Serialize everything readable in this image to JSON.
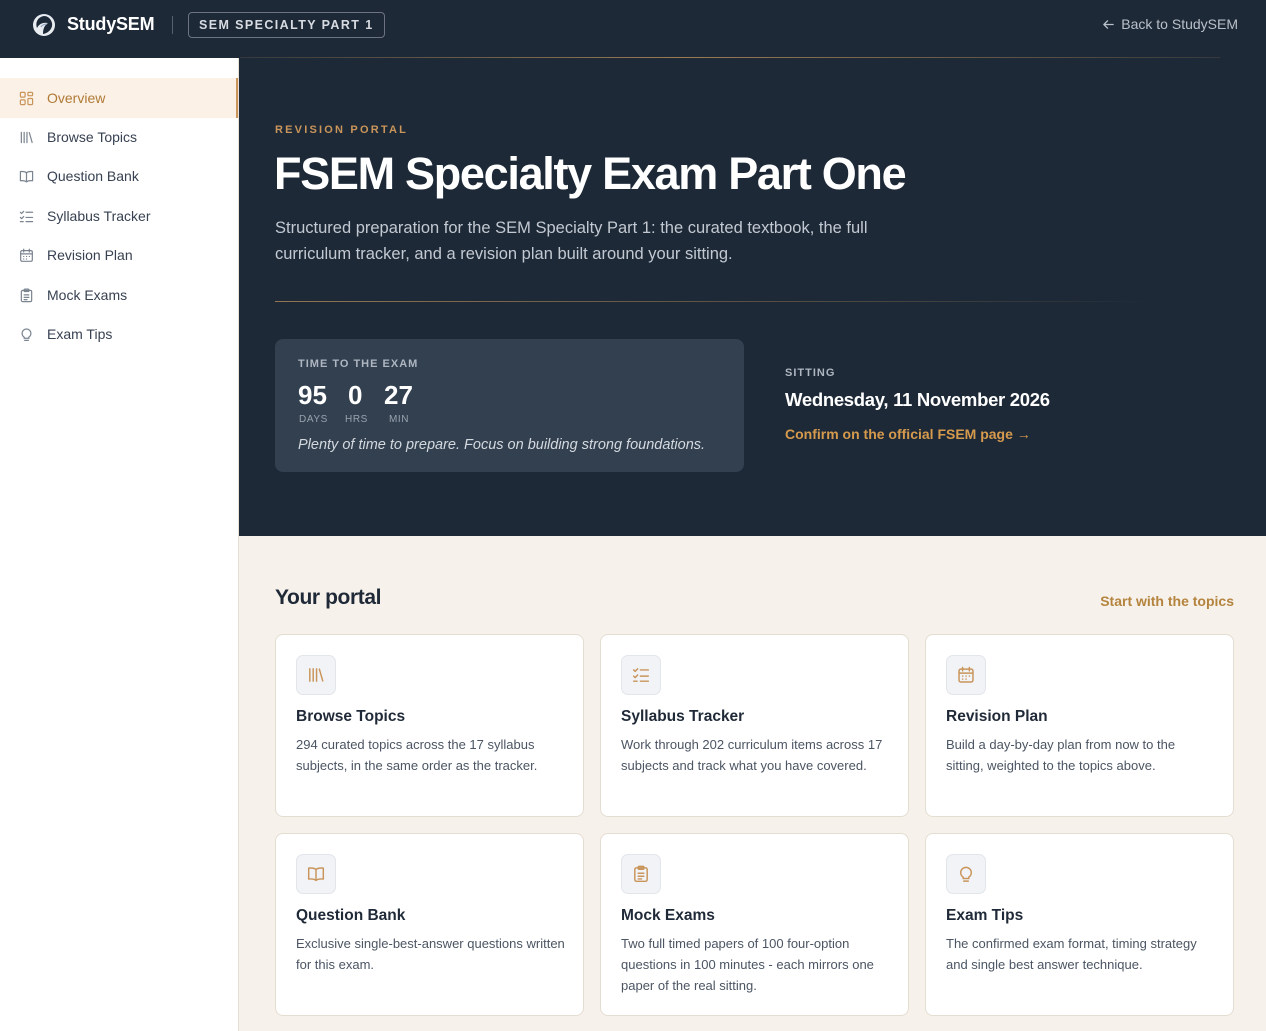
{
  "header": {
    "brand": "StudySEM",
    "badge": "SEM SPECIALTY PART 1",
    "back_link": "Back to StudySEM"
  },
  "sidebar": {
    "items": [
      {
        "label": "Overview",
        "icon": "grid-icon",
        "active": true
      },
      {
        "label": "Browse Topics",
        "icon": "library-icon",
        "active": false
      },
      {
        "label": "Question Bank",
        "icon": "book-open-icon",
        "active": false
      },
      {
        "label": "Syllabus Tracker",
        "icon": "checklist-icon",
        "active": false
      },
      {
        "label": "Revision Plan",
        "icon": "calendar-icon",
        "active": false
      },
      {
        "label": "Mock Exams",
        "icon": "clipboard-icon",
        "active": false
      },
      {
        "label": "Exam Tips",
        "icon": "lightbulb-icon",
        "active": false
      }
    ]
  },
  "hero": {
    "eyebrow": "REVISION PORTAL",
    "title": "FSEM Specialty Exam Part One",
    "subtitle": "Structured preparation for the SEM Specialty Part 1: the curated textbook, the full curriculum tracker, and a revision plan built around your sitting.",
    "countdown": {
      "label": "TIME TO THE EXAM",
      "days": "95",
      "days_unit": "DAYS",
      "hours": "0",
      "hours_unit": "HRS",
      "minutes": "27",
      "minutes_unit": "MIN",
      "message": "Plenty of time to prepare. Focus on building strong foundations."
    },
    "sitting": {
      "label": "SITTING",
      "date": "Wednesday, 11 November 2026",
      "link": "Confirm on the official FSEM page →"
    }
  },
  "portal": {
    "title": "Your portal",
    "link": "Start with the topics",
    "cards": [
      {
        "title": "Browse Topics",
        "icon": "library-icon",
        "desc": "294 curated topics across the 17 syllabus subjects, in the same order as the tracker."
      },
      {
        "title": "Syllabus Tracker",
        "icon": "checklist-icon",
        "desc": "Work through 202 curriculum items across 17 subjects and track what you have covered."
      },
      {
        "title": "Revision Plan",
        "icon": "calendar-icon",
        "desc": "Build a day-by-day plan from now to the sitting, weighted to the topics above."
      },
      {
        "title": "Question Bank",
        "icon": "book-open-icon",
        "desc": "Exclusive single-best-answer questions written for this exam."
      },
      {
        "title": "Mock Exams",
        "icon": "clipboard-icon",
        "desc": "Two full timed papers of 100 four-option questions in 100 minutes - each mirrors one paper of the real sitting."
      },
      {
        "title": "Exam Tips",
        "icon": "lightbulb-icon",
        "desc": "The confirmed exam format, timing strategy and single best answer technique."
      }
    ]
  },
  "colors": {
    "navy": "#1d2937",
    "accent": "#c9955a",
    "cream": "#f6f1ea"
  }
}
